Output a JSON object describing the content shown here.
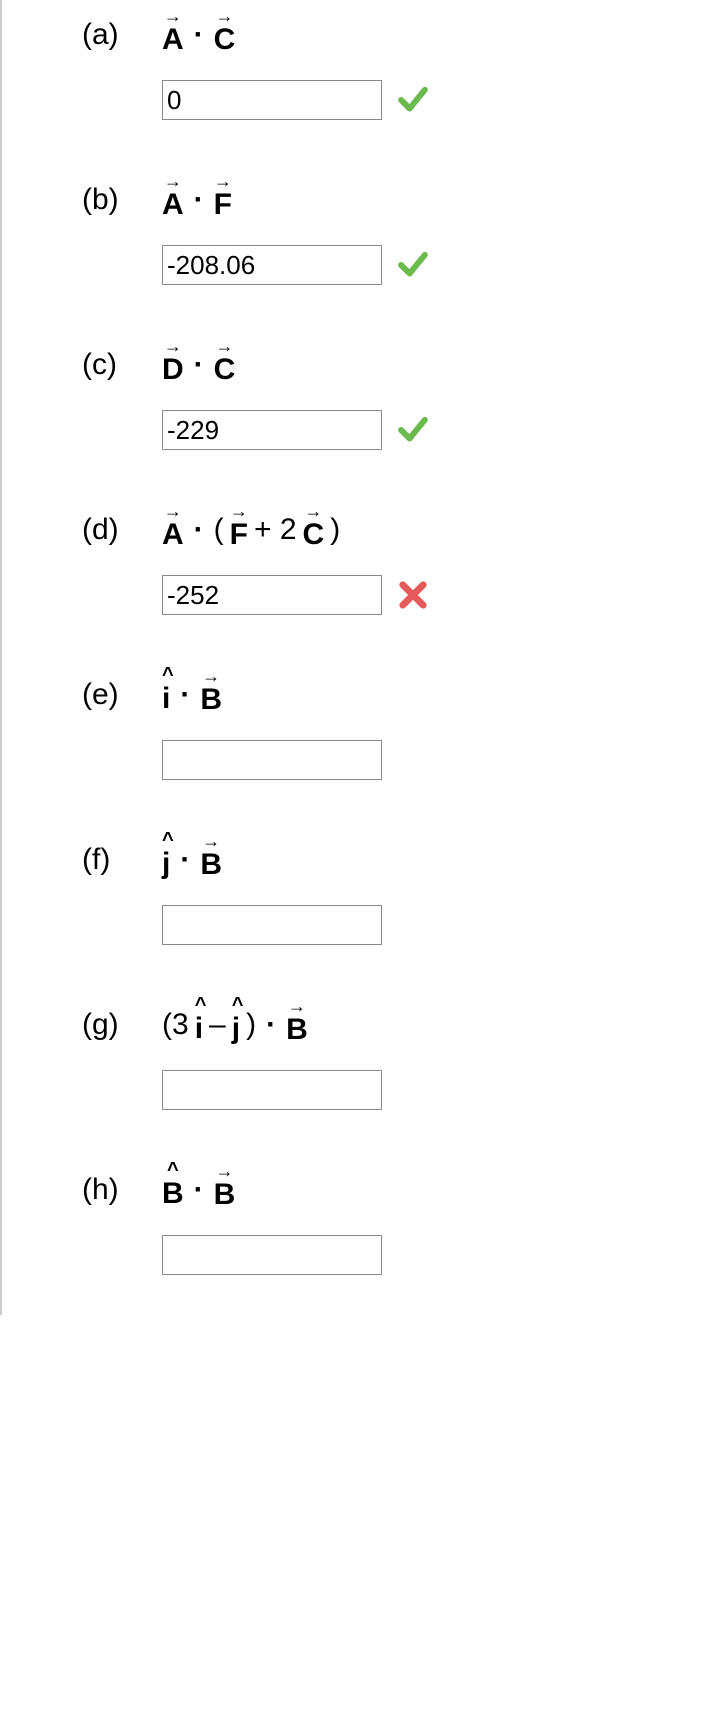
{
  "questions": {
    "a": {
      "label": "(a)",
      "letter1": "A",
      "op": "·",
      "letter2": "C",
      "answer": "0",
      "status": "correct"
    },
    "b": {
      "label": "(b)",
      "letter1": "A",
      "op": "·",
      "letter2": "F",
      "answer": "-208.06",
      "status": "correct"
    },
    "c": {
      "label": "(c)",
      "letter1": "D",
      "op": "·",
      "letter2": "C",
      "answer": "-229",
      "status": "correct"
    },
    "d": {
      "label": "(d)",
      "letter1": "A",
      "op": "·",
      "paren_open": "(",
      "letter2": "F",
      "plus": " + 2",
      "letter3": "C",
      "paren_close": ")",
      "answer": "-252",
      "status": "incorrect"
    },
    "e": {
      "label": "(e)",
      "letter1": "î",
      "op": "·",
      "letter2": "B",
      "answer": "",
      "status": ""
    },
    "f": {
      "label": "(f)",
      "letter1": "ĵ",
      "op": "·",
      "letter2": "B",
      "answer": "",
      "status": ""
    },
    "g": {
      "label": "(g)",
      "paren_open": "(3",
      "letter1": "î",
      "minus": " – ",
      "letter2": "ĵ",
      "paren_close": ")",
      "op": "·",
      "letter3": "B",
      "answer": "",
      "status": ""
    },
    "h": {
      "label": "(h)",
      "letter1": "B̂",
      "op": "·",
      "letter2": "B",
      "answer": "",
      "status": ""
    }
  }
}
